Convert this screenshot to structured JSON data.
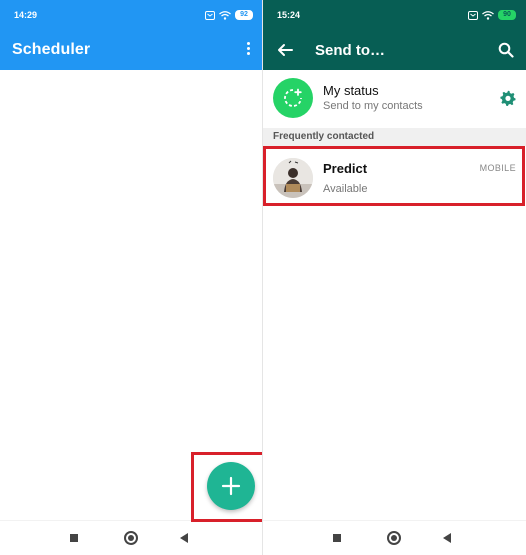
{
  "left_screen": {
    "status_bar": {
      "time": "14:29",
      "battery": "92"
    },
    "app_bar": {
      "title": "Scheduler"
    },
    "fab": {
      "icon": "plus-icon",
      "color": "#1fb594"
    },
    "accent": "#2196f3"
  },
  "right_screen": {
    "status_bar": {
      "time": "15:24",
      "battery": "90"
    },
    "app_bar": {
      "title": "Send to…"
    },
    "my_status": {
      "title": "My status",
      "subtitle": "Send to my contacts"
    },
    "section_header": "Frequently contacted",
    "contacts": [
      {
        "name": "Predict",
        "status": "Available",
        "tag": "MOBILE"
      }
    ],
    "accent": "#075e54",
    "status_color": "#25d366"
  },
  "highlight_color": "#d8202a"
}
